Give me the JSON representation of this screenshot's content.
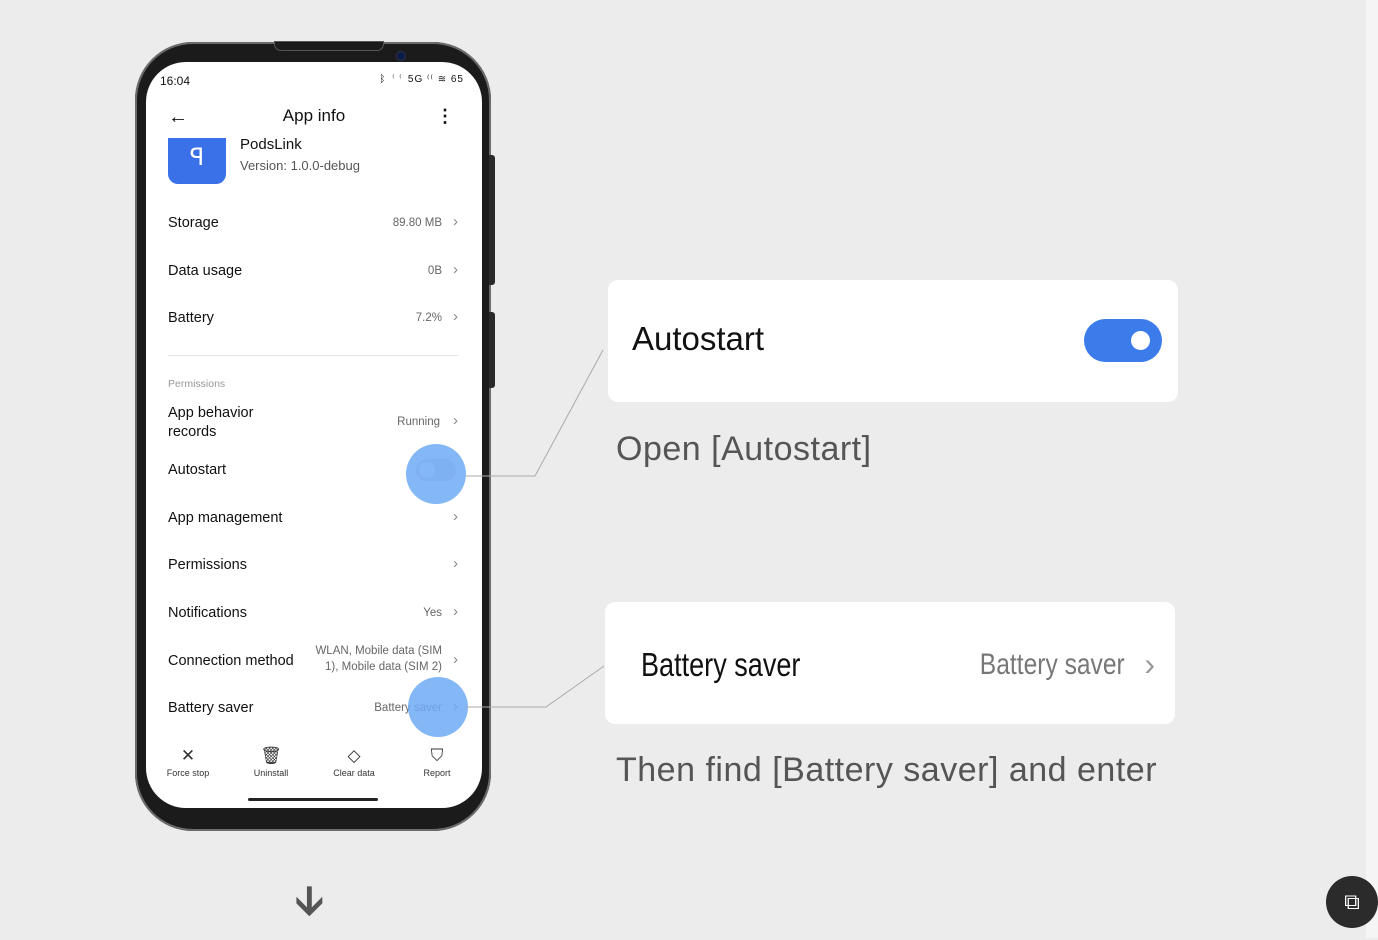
{
  "status": {
    "time": "16:04",
    "icons": "ᛒ ⁽⁽ 5G ⁽⁽ ≋ 65"
  },
  "header": {
    "title": "App info",
    "back_icon": "←",
    "more_icon": "⋮"
  },
  "app": {
    "name": "PodsLink",
    "version": "Version: 1.0.0-debug",
    "icon_glyph": "ꟼ"
  },
  "rows": {
    "storage": {
      "label": "Storage",
      "value": "89.80 MB"
    },
    "data_usage": {
      "label": "Data usage",
      "value": "0B"
    },
    "battery": {
      "label": "Battery",
      "value": "7.2%"
    },
    "section": "Permissions",
    "app_behavior": {
      "label_1": "App behavior",
      "label_2": "records",
      "value": "Running"
    },
    "autostart": {
      "label": "Autostart",
      "enabled": false
    },
    "app_management": {
      "label": "App management"
    },
    "permissions": {
      "label": "Permissions"
    },
    "notifications": {
      "label": "Notifications",
      "value": "Yes"
    },
    "connection": {
      "label": "Connection method",
      "value_1": "WLAN, Mobile data (SIM",
      "value_2": "1), Mobile data (SIM 2)"
    },
    "battery_saver": {
      "label": "Battery saver",
      "value": "Battery saver"
    }
  },
  "chevron": "›",
  "bottom_bar": [
    {
      "label": "Force stop",
      "icon": "✕"
    },
    {
      "label": "Uninstall",
      "icon": "🗑"
    },
    {
      "label": "Clear data",
      "icon": "◇"
    },
    {
      "label": "Report",
      "icon": "⛉"
    }
  ],
  "callout_autostart": {
    "label": "Autostart",
    "enabled": true,
    "caption": "Open [Autostart]"
  },
  "callout_battery": {
    "label": "Battery saver",
    "value": "Battery saver",
    "caption": "Then find [Battery saver] and enter"
  },
  "colors": {
    "accent": "#3b7bea",
    "highlight": "#6eaaf5"
  }
}
